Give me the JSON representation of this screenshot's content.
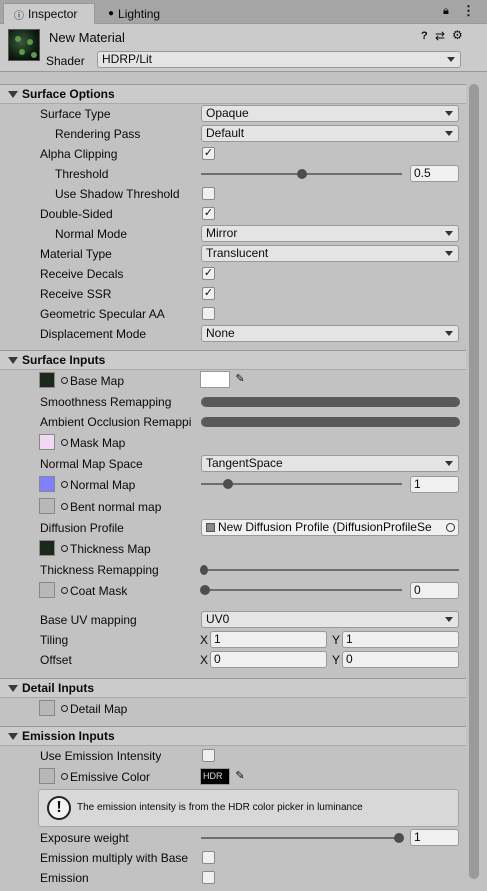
{
  "tabs": [
    {
      "label": "Inspector",
      "icon": "info-icon"
    },
    {
      "label": "Lighting",
      "icon": "bulb-icon"
    }
  ],
  "header": {
    "title": "New Material",
    "shader_label": "Shader",
    "shader_value": "HDRP/Lit"
  },
  "sections": {
    "surface_options": "Surface Options",
    "surface_inputs": "Surface Inputs",
    "detail_inputs": "Detail Inputs",
    "emission_inputs": "Emission Inputs"
  },
  "surface_options": {
    "surface_type": {
      "label": "Surface Type",
      "value": "Opaque"
    },
    "rendering_pass": {
      "label": "Rendering Pass",
      "value": "Default"
    },
    "alpha_clipping": {
      "label": "Alpha Clipping",
      "checked": true
    },
    "threshold": {
      "label": "Threshold",
      "value": "0.5",
      "slider": 0.5
    },
    "use_shadow_threshold": {
      "label": "Use Shadow Threshold",
      "checked": false
    },
    "double_sided": {
      "label": "Double-Sided",
      "checked": true
    },
    "normal_mode": {
      "label": "Normal Mode",
      "value": "Mirror"
    },
    "material_type": {
      "label": "Material Type",
      "value": "Translucent"
    },
    "receive_decals": {
      "label": "Receive Decals",
      "checked": true
    },
    "receive_ssr": {
      "label": "Receive SSR",
      "checked": true
    },
    "geometric_specular_aa": {
      "label": "Geometric Specular AA",
      "checked": false
    },
    "displacement_mode": {
      "label": "Displacement Mode",
      "value": "None"
    }
  },
  "surface_inputs": {
    "base_map": "Base Map",
    "smoothness_remapping": "Smoothness Remapping",
    "ao_remapping": "Ambient Occlusion Remappi",
    "mask_map": "Mask Map",
    "normal_map_space": {
      "label": "Normal Map Space",
      "value": "TangentSpace"
    },
    "normal_map": {
      "label": "Normal Map",
      "value": "1",
      "slider": 0.1
    },
    "bent_normal_map": "Bent normal map",
    "diffusion_profile": {
      "label": "Diffusion Profile",
      "value": "New Diffusion Profile (DiffusionProfileSe"
    },
    "thickness_map": "Thickness Map",
    "thickness_remapping": "Thickness Remapping",
    "coat_mask": {
      "label": "Coat Mask",
      "value": "0",
      "slider": 0
    },
    "base_uv_mapping": {
      "label": "Base UV mapping",
      "value": "UV0"
    },
    "tiling": {
      "label": "Tiling",
      "x_label": "X",
      "x": "1",
      "y_label": "Y",
      "y": "1"
    },
    "offset": {
      "label": "Offset",
      "x_label": "X",
      "x": "0",
      "y_label": "Y",
      "y": "0"
    }
  },
  "detail_inputs": {
    "detail_map": "Detail Map"
  },
  "emission_inputs": {
    "use_emission_intensity": {
      "label": "Use Emission Intensity",
      "checked": false
    },
    "emissive_color": {
      "label": "Emissive Color",
      "hdr": "HDR"
    },
    "help_text": "The emission intensity is from the HDR color picker in luminance",
    "exposure_weight": {
      "label": "Exposure weight",
      "value": "1",
      "slider": 1
    },
    "emission_multiply": {
      "label": "Emission multiply with Base",
      "checked": false
    },
    "emission": {
      "label": "Emission",
      "checked": false
    }
  },
  "colors": {
    "panel": "#c2c2c2",
    "header": "#cbcbcb",
    "normal_map_swatch": "#8080ff"
  }
}
